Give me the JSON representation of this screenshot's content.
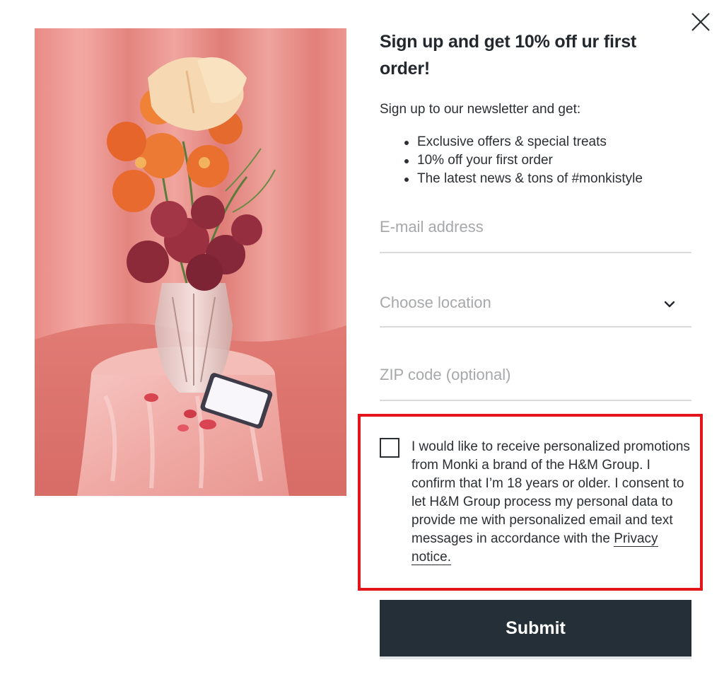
{
  "popup": {
    "heading": "Sign up and get 10% off ur first order!",
    "intro": "Sign up to our newsletter and get:",
    "benefits": [
      "Exclusive offers & special treats",
      "10% off your first order",
      "The latest news & tons of #monkistyle"
    ],
    "close_icon": "close-icon"
  },
  "form": {
    "email_placeholder": "E-mail address",
    "email_value": "",
    "location_placeholder": "Choose location",
    "location_icon": "chevron-down-icon",
    "zip_placeholder": "ZIP code (optional)",
    "zip_value": "",
    "consent_checked": false,
    "consent_text": "I would like to receive personalized promotions from Monki a brand of the H&M Group. I confirm that I’m 18 years or older. I consent to let H&M Group process my personal data to provide me with personalized email and text messages in accordance with the",
    "privacy_link": "Privacy notice.",
    "submit_label": "Submit"
  },
  "colors": {
    "highlight_border": "#e3141c",
    "submit_bg": "#242f38",
    "field_underline": "#d9dadb",
    "photo_backdrop": "#e8908a"
  }
}
